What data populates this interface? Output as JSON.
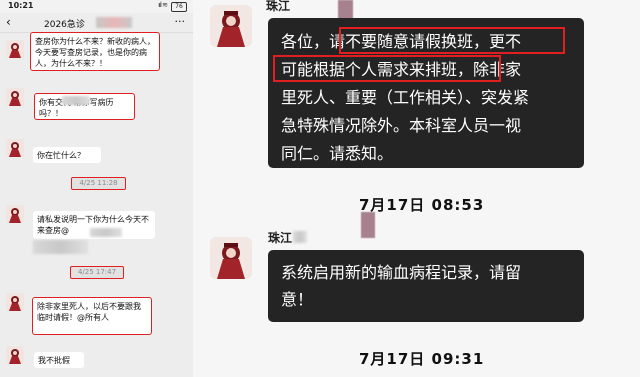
{
  "left": {
    "status_time": "10:21",
    "status_signal": "ııl ≋",
    "status_battery": "76",
    "nav_back": "‹",
    "nav_title": "2026急诊",
    "nav_more": "···",
    "messages": [
      {
        "text": "查房你为什么不来？新收的病人，今天要写查房记录，也是你的病人，为什么不来？！"
      },
      {
        "text": "你有交代        帮你写病历吗？！"
      },
      {
        "text": "你在忙什么？"
      },
      {
        "text": "请私发说明一下你为什么今天不来查房@"
      },
      {
        "text": "除非家里死人，以后不要跟我临时请假！@所有人"
      },
      {
        "text": "我不批假"
      }
    ],
    "timestamps": [
      "4/25 11:28",
      "4/25 17:47"
    ]
  },
  "right": {
    "sender1": "珠江",
    "sender2": "珠江",
    "bubble1_lines": [
      "各位，请不要随意请假换班，更不",
      "可能根据个人需求来排班，除非家",
      "里死人、重要（工作相关）、突发紧",
      "急特殊情况除外。本科室人员一视",
      "同仁。请悉知。"
    ],
    "timestamp1": "7月17日 08:53",
    "bubble2_lines": [
      "系统启用新的输血病程记录，请留",
      "意！"
    ],
    "timestamp2": "7月17日 09:31"
  },
  "colors": {
    "highlight": "#e02020",
    "dark_bubble": "#242424"
  }
}
